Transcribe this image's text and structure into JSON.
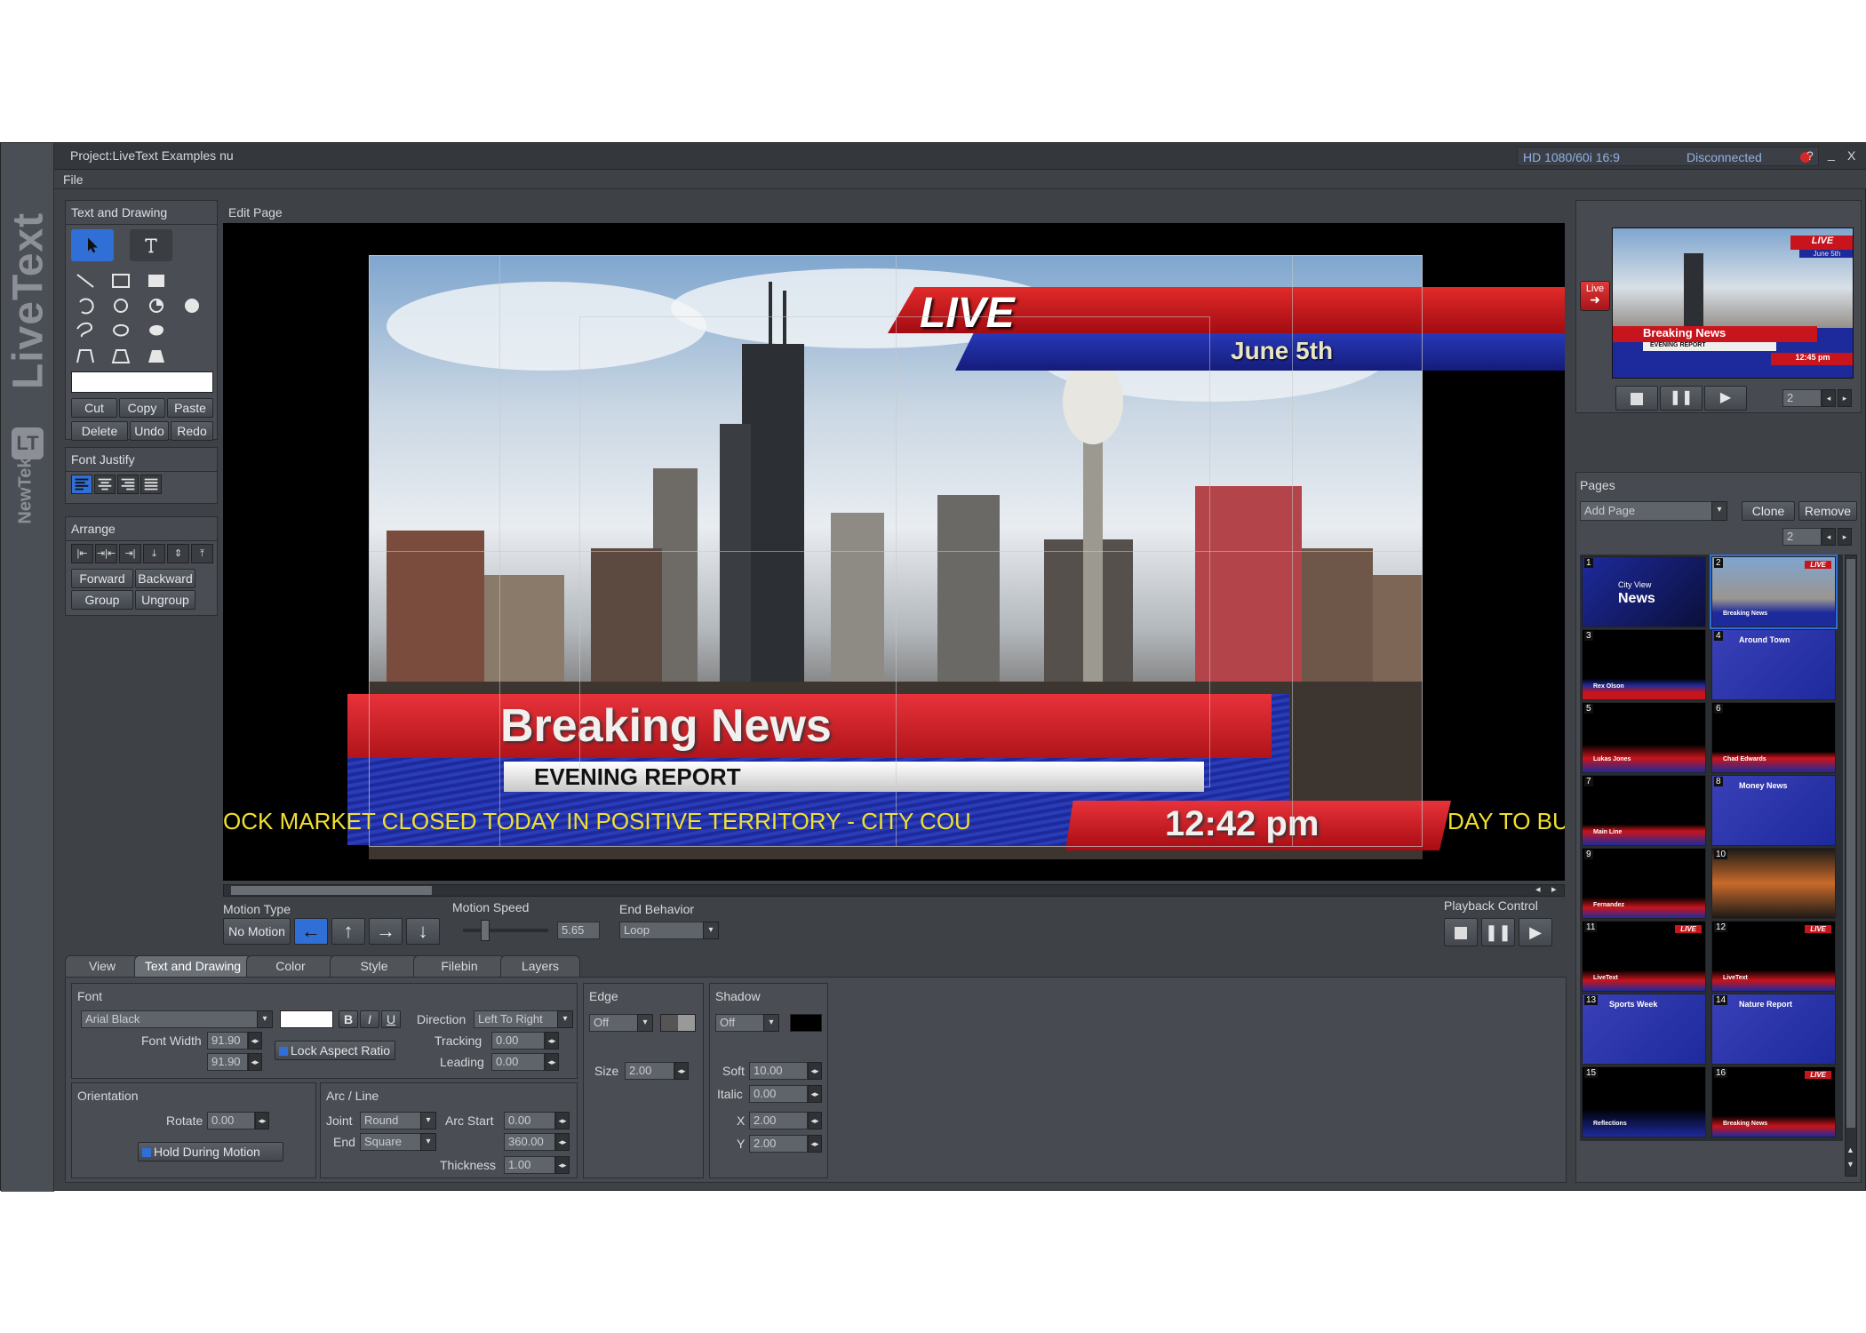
{
  "window": {
    "title": "Project:LiveText Examples nu",
    "format": "HD 1080/60i 16:9",
    "status": "Disconnected",
    "help": "?",
    "minimize": "_",
    "close": "X"
  },
  "menu": {
    "file": "File"
  },
  "brand": {
    "livetext": "LiveText",
    "tm": "™",
    "newtek": "NewTek"
  },
  "text_drawing": {
    "title": "Text and Drawing",
    "cut": "Cut",
    "copy": "Copy",
    "paste": "Paste",
    "delete": "Delete",
    "undo": "Undo",
    "redo": "Redo"
  },
  "font_justify": {
    "title": "Font Justify"
  },
  "arrange": {
    "title": "Arrange",
    "forward": "Forward",
    "backward": "Backward",
    "group": "Group",
    "ungroup": "Ungroup"
  },
  "edit_page": {
    "title": "Edit Page",
    "live": "LIVE",
    "date": "June 5th",
    "headline": "Breaking News",
    "subhead": "EVENING REPORT",
    "ticker": "OCK MARKET CLOSED TODAY IN POSITIVE TERRITORY - CITY COU",
    "ticker_right": "DAY TO BU",
    "clock": "12:42 pm"
  },
  "motion": {
    "type_label": "Motion Type",
    "type_value": "No Motion",
    "speed_label": "Motion Speed",
    "speed_value": "5.65",
    "end_label": "End Behavior",
    "end_value": "Loop",
    "playback_label": "Playback Control"
  },
  "tabs": [
    "View",
    "Text and Drawing",
    "Color",
    "Style",
    "Filebin",
    "Layers"
  ],
  "font": {
    "title": "Font",
    "family": "Arial Black",
    "bold": "B",
    "italic": "I",
    "underline": "U",
    "direction_label": "Direction",
    "direction_value": "Left To Right",
    "width_label": "Font Width",
    "width_value": "91.90",
    "height_value": "91.90",
    "lock_label": "Lock Aspect Ratio",
    "tracking_label": "Tracking",
    "tracking_value": "0.00",
    "leading_label": "Leading",
    "leading_value": "0.00"
  },
  "orientation": {
    "title": "Orientation",
    "rotate_label": "Rotate",
    "rotate_value": "0.00",
    "hold_label": "Hold During Motion"
  },
  "arc": {
    "title": "Arc / Line",
    "joint_label": "Joint",
    "joint_value": "Round",
    "end_label": "End",
    "end_value": "Square",
    "arc_start_label": "Arc Start",
    "arc_start_value": "0.00",
    "arc_end_value": "360.00",
    "thickness_label": "Thickness",
    "thickness_value": "1.00"
  },
  "edge": {
    "title": "Edge",
    "value": "Off",
    "size_label": "Size",
    "size_value": "2.00"
  },
  "shadow": {
    "title": "Shadow",
    "value": "Off",
    "soft_label": "Soft",
    "soft_value": "10.00",
    "italic_label": "Italic",
    "italic_value": "0.00",
    "x_label": "X",
    "x_value": "2.00",
    "y_label": "Y",
    "y_value": "2.00"
  },
  "preview": {
    "live_label": "Live",
    "page": "2",
    "thumb_live": "LIVE",
    "thumb_date": "June 5th",
    "thumb_headline": "Breaking News",
    "thumb_sub": "EVENING REPORT",
    "thumb_clock": "12:45 pm"
  },
  "pages": {
    "title": "Pages",
    "add": "Add Page",
    "clone": "Clone",
    "remove": "Remove",
    "page": "2",
    "items": [
      {
        "n": "1",
        "text": "News",
        "sub": "City View"
      },
      {
        "n": "2",
        "text": "Breaking News",
        "sub": "LIVE"
      },
      {
        "n": "3",
        "text": "Rex Olson",
        "sub": ""
      },
      {
        "n": "4",
        "text": "Around Town",
        "sub": ""
      },
      {
        "n": "5",
        "text": "Lukas Jones",
        "sub": ""
      },
      {
        "n": "6",
        "text": "Chad Edwards",
        "sub": ""
      },
      {
        "n": "7",
        "text": "Main Line",
        "sub": ""
      },
      {
        "n": "8",
        "text": "Money News",
        "sub": ""
      },
      {
        "n": "9",
        "text": "Fernandez",
        "sub": ""
      },
      {
        "n": "10",
        "text": "",
        "sub": ""
      },
      {
        "n": "11",
        "text": "LiveText",
        "sub": "LIVE"
      },
      {
        "n": "12",
        "text": "LiveText",
        "sub": "LIVE"
      },
      {
        "n": "13",
        "text": "Sports Week",
        "sub": ""
      },
      {
        "n": "14",
        "text": "Nature Report",
        "sub": ""
      },
      {
        "n": "15",
        "text": "Reflections",
        "sub": ""
      },
      {
        "n": "16",
        "text": "Breaking News",
        "sub": "LIVE"
      }
    ]
  },
  "colors": {
    "accent": "#2f6fd6",
    "live_red": "#c8141c",
    "blue_band": "#1d2a9c",
    "ticker_yellow": "#f0e030"
  }
}
